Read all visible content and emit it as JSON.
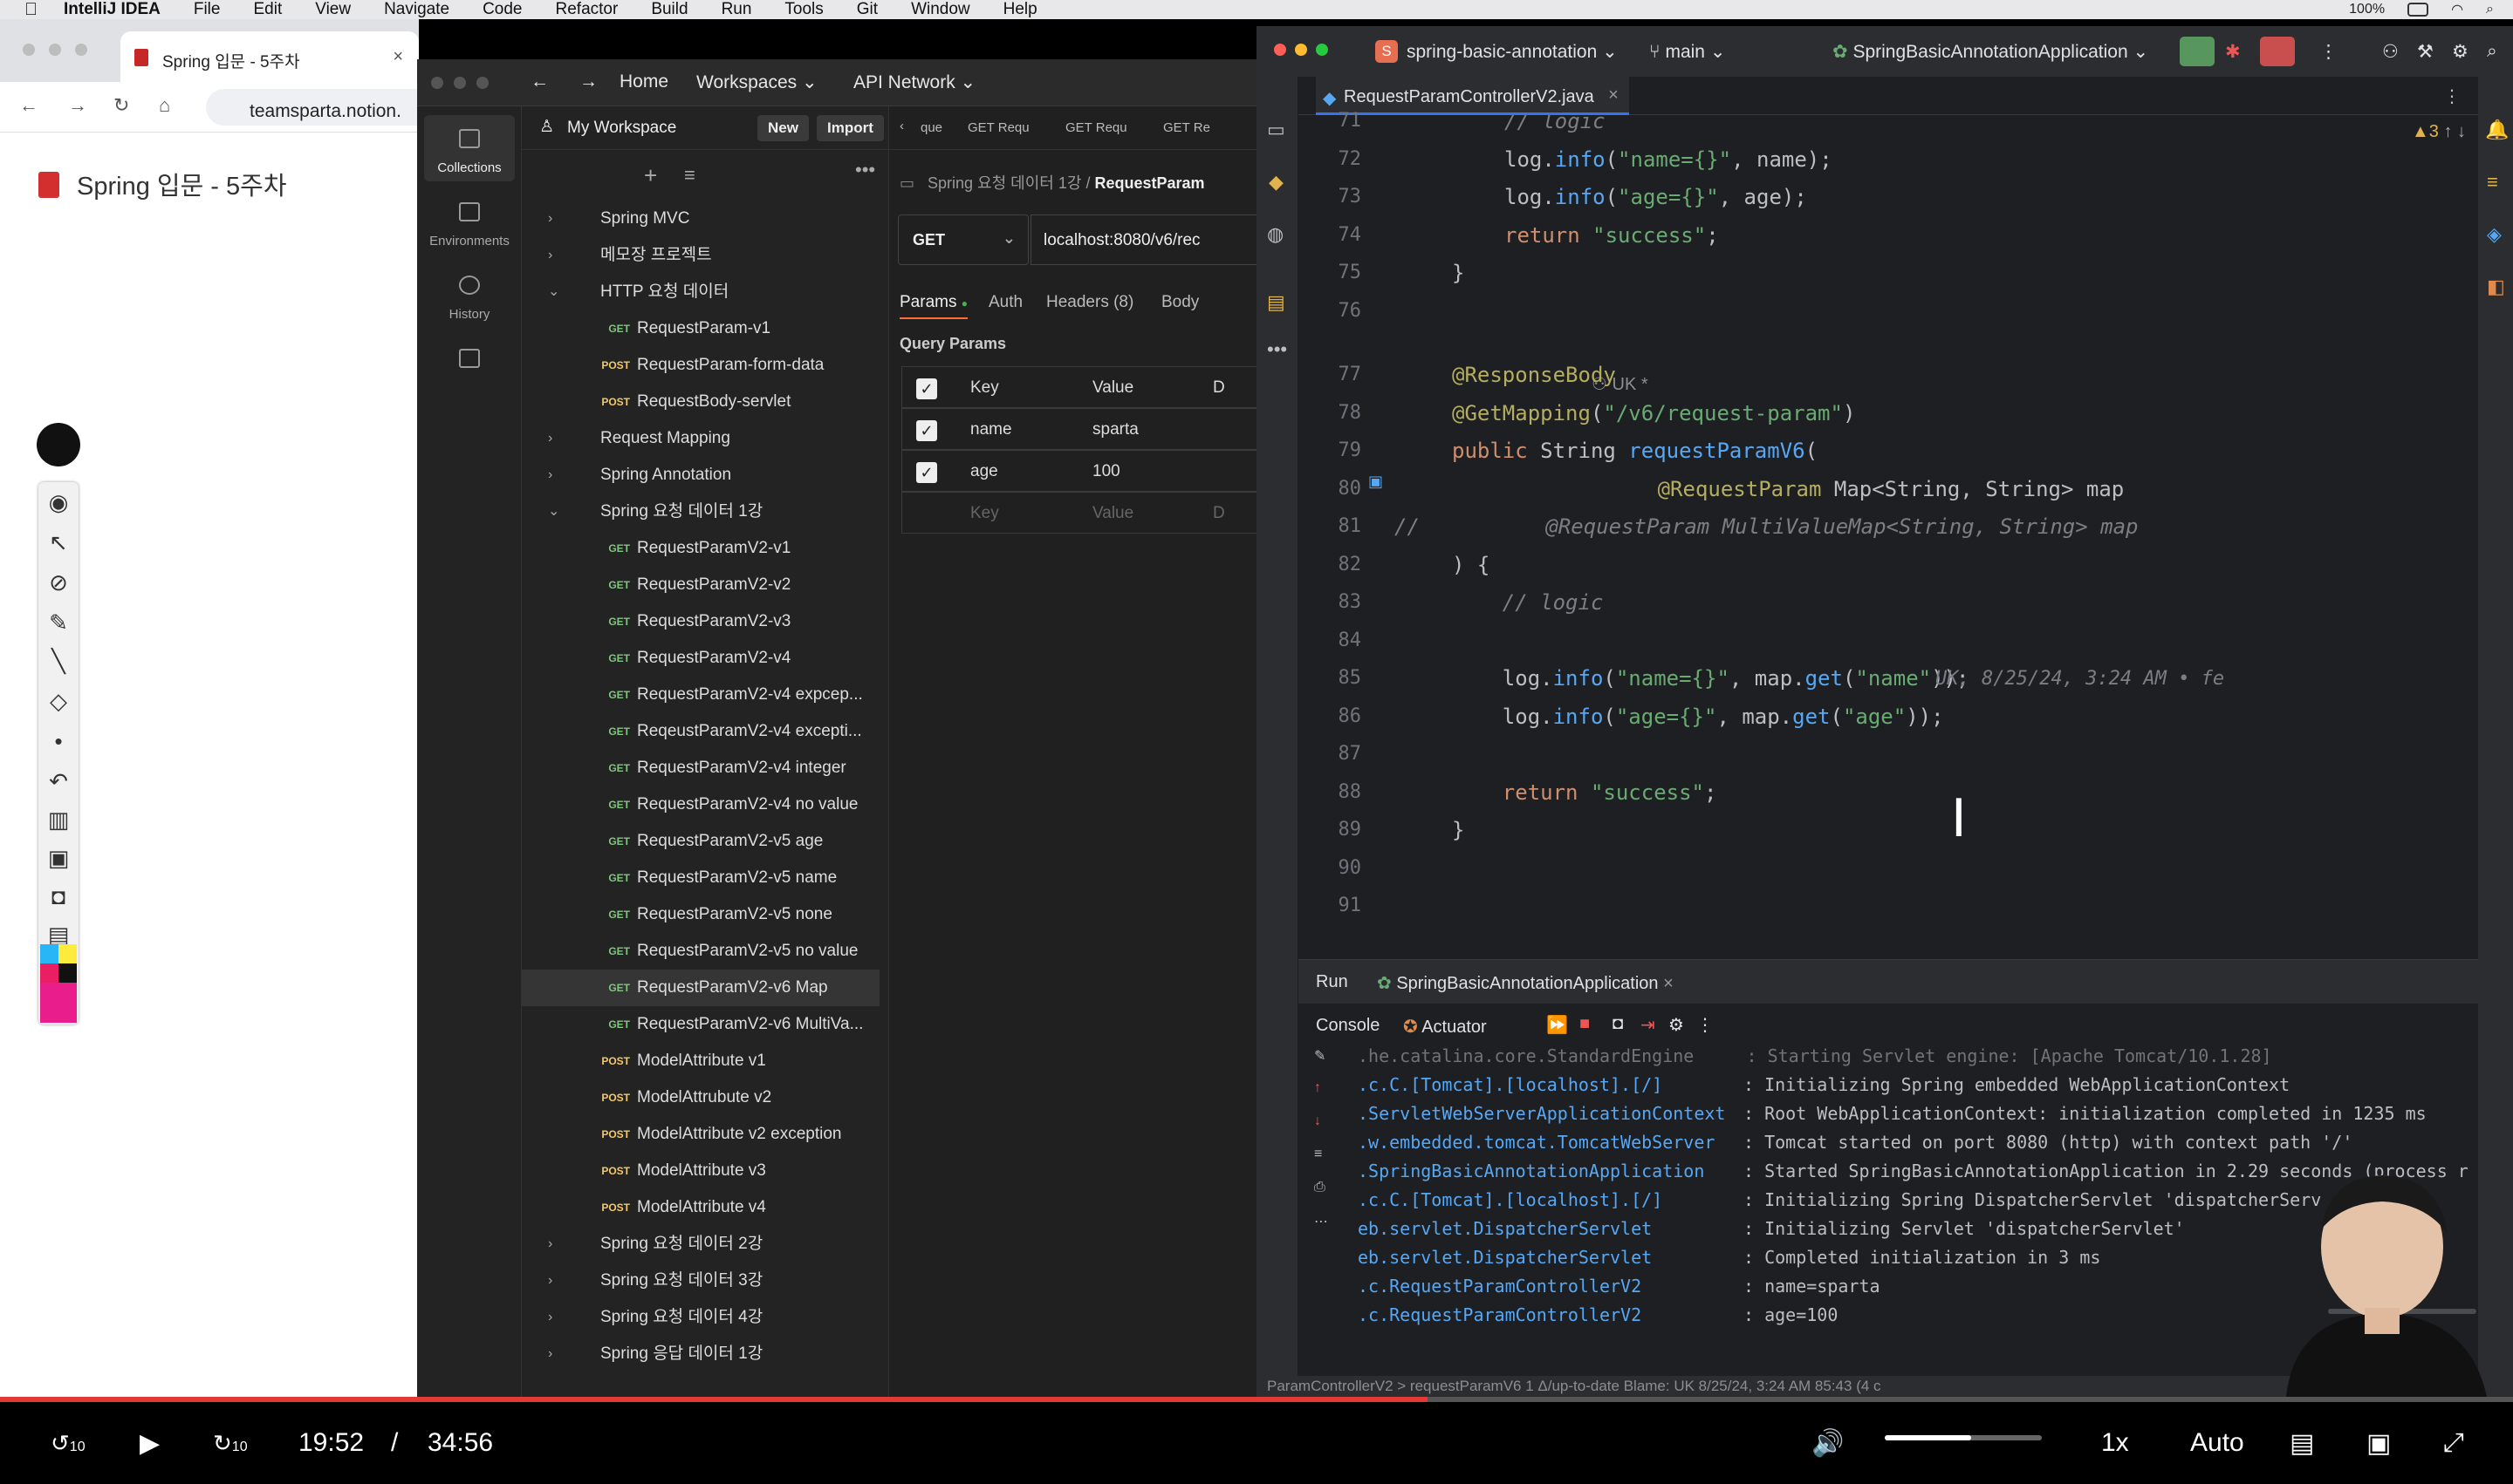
{
  "menubar": {
    "app_name": "IntelliJ IDEA",
    "items": [
      "File",
      "Edit",
      "View",
      "Navigate",
      "Code",
      "Refactor",
      "Build",
      "Run",
      "Tools",
      "Git",
      "Window",
      "Help"
    ],
    "battery": "100%"
  },
  "browser": {
    "tab_title": "Spring 입문 - 5주차",
    "url": "teamsparta.notion.",
    "page_title": "Spring 입문 - 5주차"
  },
  "postman": {
    "nav": {
      "home": "Home",
      "workspaces": "Workspaces",
      "api_network": "API Network"
    },
    "workspace_name": "My Workspace",
    "new_label": "New",
    "import_label": "Import",
    "rail": [
      "Collections",
      "Environments",
      "History"
    ],
    "tree": [
      {
        "label": "Spring MVC",
        "type": "folder",
        "expanded": false
      },
      {
        "label": "메모장 프로젝트",
        "type": "folder",
        "expanded": false
      },
      {
        "label": "HTTP 요청 데이터",
        "type": "folder",
        "expanded": true
      },
      {
        "label": "RequestParam-v1",
        "type": "req",
        "method": "GET"
      },
      {
        "label": "RequestParam-form-data",
        "type": "req",
        "method": "POST"
      },
      {
        "label": "RequestBody-servlet",
        "type": "req",
        "method": "POST"
      },
      {
        "label": "Request Mapping",
        "type": "folder",
        "expanded": false
      },
      {
        "label": "Spring Annotation",
        "type": "folder",
        "expanded": false
      },
      {
        "label": "Spring 요청 데이터 1강",
        "type": "folder",
        "expanded": true
      },
      {
        "label": "RequestParamV2-v1",
        "type": "req",
        "method": "GET"
      },
      {
        "label": "RequestParamV2-v2",
        "type": "req",
        "method": "GET"
      },
      {
        "label": "RequestParamV2-v3",
        "type": "req",
        "method": "GET"
      },
      {
        "label": "RequestParamV2-v4",
        "type": "req",
        "method": "GET"
      },
      {
        "label": "RequestParamV2-v4 expcep...",
        "type": "req",
        "method": "GET"
      },
      {
        "label": "ReqeustParamV2-v4 excepti...",
        "type": "req",
        "method": "GET"
      },
      {
        "label": "RequestParamV2-v4 integer",
        "type": "req",
        "method": "GET"
      },
      {
        "label": "RequestParamV2-v4 no value",
        "type": "req",
        "method": "GET"
      },
      {
        "label": "RequestParamV2-v5 age",
        "type": "req",
        "method": "GET"
      },
      {
        "label": "RequestParamV2-v5 name",
        "type": "req",
        "method": "GET"
      },
      {
        "label": "RequestParamV2-v5 none",
        "type": "req",
        "method": "GET"
      },
      {
        "label": "RequestParamV2-v5 no value",
        "type": "req",
        "method": "GET"
      },
      {
        "label": "RequestParamV2-v6 Map",
        "type": "req",
        "method": "GET",
        "selected": true
      },
      {
        "label": "RequestParamV2-v6 MultiVa...",
        "type": "req",
        "method": "GET"
      },
      {
        "label": "ModelAttribute v1",
        "type": "req",
        "method": "POST"
      },
      {
        "label": "ModelAttrubute v2",
        "type": "req",
        "method": "POST"
      },
      {
        "label": "ModelAttribute v2 exception",
        "type": "req",
        "method": "POST"
      },
      {
        "label": "ModelAttribute v3",
        "type": "req",
        "method": "POST"
      },
      {
        "label": "ModelAttribute v4",
        "type": "req",
        "method": "POST"
      },
      {
        "label": "Spring 요청 데이터 2강",
        "type": "folder",
        "expanded": false
      },
      {
        "label": "Spring 요청 데이터 3강",
        "type": "folder",
        "expanded": false
      },
      {
        "label": "Spring 요청 데이터 4강",
        "type": "folder",
        "expanded": false
      },
      {
        "label": "Spring 응답 데이터 1강",
        "type": "folder",
        "expanded": false
      }
    ],
    "req_tabs": [
      "GET Requ",
      "GET Requ",
      "GET Re"
    ],
    "req_tab_first": "que",
    "breadcrumb": {
      "parent": "Spring 요청 데이터 1강",
      "sep": "/",
      "current": "RequestParam"
    },
    "method": "GET",
    "url": "localhost:8080/v6/rec",
    "subtabs": [
      "Params",
      "Auth",
      "Headers (8)",
      "Body"
    ],
    "query_params_label": "Query Params",
    "table_head": {
      "key": "Key",
      "value": "Value",
      "desc": "D"
    },
    "params": [
      {
        "key": "name",
        "value": "sparta"
      },
      {
        "key": "age",
        "value": "100"
      }
    ],
    "placeholder": {
      "key": "Key",
      "value": "Value",
      "desc": "D"
    }
  },
  "ide": {
    "project": "spring-basic-annotation",
    "branch": "main",
    "run_config": "SpringBasicAnnotationApplication",
    "file_tab": "RequestParamControllerV2.java",
    "warnings": "3",
    "author_hint": "UK *",
    "inline_blame": "UK, 8/25/24, 3:24 AM • fe",
    "lines": [
      {
        "n": "71",
        "html": "<span class='cm'>// logic</span>"
      },
      {
        "n": "72",
        "html": "log.<span class='fn'>info</span>(<span class='str'>\"name={}\"</span>, name);"
      },
      {
        "n": "73",
        "html": "log.<span class='fn'>info</span>(<span class='str'>\"age={}\"</span>, age);"
      },
      {
        "n": "74",
        "html": "<span class='kw'>return</span> <span class='str'>\"success\"</span>;"
      },
      {
        "n": "75",
        "html": "}"
      },
      {
        "n": "76",
        "html": ""
      },
      {
        "n": "77",
        "html": "<span class='an'>@ResponseBody</span>"
      },
      {
        "n": "78",
        "html": "<span class='an'>@GetMapping</span>(<span class='str'>\"/v6/request-param\"</span>)"
      },
      {
        "n": "79",
        "html": "<span class='kw'>public</span> String <span class='fn'>requestParamV6</span>("
      },
      {
        "n": "80",
        "html": "        <span class='an'>@RequestParam</span> Map&lt;String, String&gt; map"
      },
      {
        "n": "81",
        "html": "<span class='cm'>//          @RequestParam MultiValueMap&lt;String, String&gt; map</span>"
      },
      {
        "n": "82",
        "html": ") {"
      },
      {
        "n": "83",
        "html": "    <span class='cm'>// logic</span>"
      },
      {
        "n": "84",
        "html": ""
      },
      {
        "n": "85",
        "html": "    log.<span class='fn'>info</span>(<span class='str'>\"name={}\"</span>, map.<span class='fn'>get</span>(<span class='str'>\"name\"</span>));"
      },
      {
        "n": "86",
        "html": "    log.<span class='fn'>info</span>(<span class='str'>\"age={}\"</span>, map.<span class='fn'>get</span>(<span class='str'>\"age\"</span>));"
      },
      {
        "n": "87",
        "html": ""
      },
      {
        "n": "88",
        "html": "    <span class='kw'>return</span> <span class='str'>\"success\"</span>;"
      },
      {
        "n": "89",
        "html": "}"
      },
      {
        "n": "90",
        "html": ""
      },
      {
        "n": "91",
        "html": ""
      }
    ],
    "run_tab": "Run",
    "run_app": "SpringBasicAnnotationApplication",
    "console_tab": "Console",
    "actuator_tab": "Actuator",
    "log": [
      {
        "src": ".c.C.[Tomcat].[localhost].[/]",
        "msg": ": Initializing Spring embedded WebApplicationContext"
      },
      {
        "src": ".ServletWebServerApplicationContext",
        "msg": ": Root WebApplicationContext: initialization completed in 1235 ms"
      },
      {
        "src": ".w.embedded.tomcat.TomcatWebServer",
        "msg": ": Tomcat started on port 8080 (http) with context path '/'"
      },
      {
        "src": ".SpringBasicAnnotationApplication",
        "msg": ": Started SpringBasicAnnotationApplication in 2.29 seconds (process r"
      },
      {
        "src": ".c.C.[Tomcat].[localhost].[/]",
        "msg": ": Initializing Spring DispatcherServlet 'dispatcherServ"
      },
      {
        "src": "eb.servlet.DispatcherServlet",
        "msg": ": Initializing Servlet 'dispatcherServlet'"
      },
      {
        "src": "eb.servlet.DispatcherServlet",
        "msg": ": Completed initialization in 3 ms"
      },
      {
        "src": ".c.RequestParamControllerV2",
        "msg": ": name=sparta"
      },
      {
        "src": ".c.RequestParamControllerV2",
        "msg": ": age=100"
      }
    ],
    "log_head_partial": ".he.catalina.core.StandardEngine     : Starting Servlet engine: [Apache Tomcat/10.1.28]",
    "status": "ParamControllerV2 > requestParamV6    1 Δ/up-to-date   Blame: UK 8/25/24, 3:24 AM   85:43 (4 c"
  },
  "video": {
    "current": "19:52",
    "sep": "/",
    "total": "34:56",
    "speed": "1x",
    "quality": "Auto",
    "progress": 0.568,
    "volume": 0.55,
    "skip_back": "10",
    "skip_fwd": "10"
  }
}
